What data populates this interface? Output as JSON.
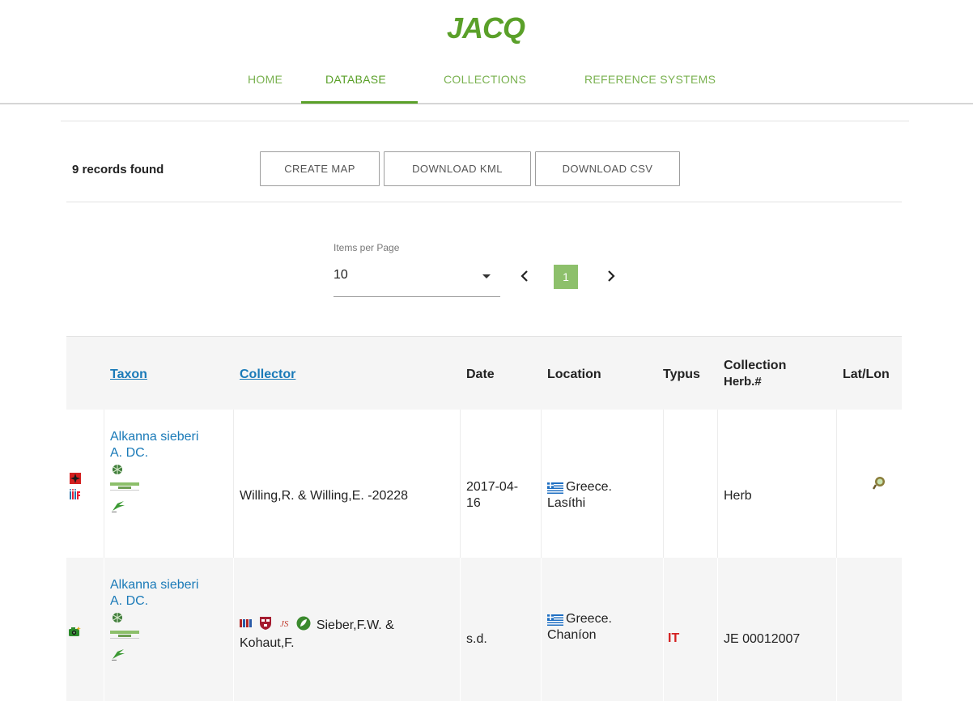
{
  "app": {
    "logo_text": "JACQ",
    "colors": {
      "brand_green": "#5aa029",
      "nav_green": "#79b14f",
      "link_blue": "#1a7ab8",
      "typus_red": "#d42020",
      "page_active": "#8dc06b"
    }
  },
  "nav": {
    "items": [
      {
        "label": "HOME"
      },
      {
        "label": "DATABASE",
        "active": true
      },
      {
        "label": "COLLECTIONS"
      },
      {
        "label": "REFERENCE SYSTEMS"
      }
    ]
  },
  "results": {
    "count_label": "9 records found",
    "buttons": {
      "create_map": "CREATE MAP",
      "download_kml": "DOWNLOAD KML",
      "download_csv": "DOWNLOAD CSV"
    }
  },
  "paging": {
    "items_per_page_label": "Items per Page",
    "items_per_page_value": "10",
    "current_page": "1",
    "prev_icon": "chevron-left-icon",
    "next_icon": "chevron-right-icon"
  },
  "table": {
    "headers": {
      "taxon": "Taxon",
      "collector": "Collector",
      "date": "Date",
      "location": "Location",
      "typus": "Typus",
      "collection_line1": "Collection",
      "collection_line2": "Herb.#",
      "latlon": "Lat/Lon"
    },
    "rows": [
      {
        "status_icons": [
          "red-star-icon",
          "iiif-icon"
        ],
        "taxon_line1": "Alkanna sieberi",
        "taxon_line2": "A. DC.",
        "taxon_icons": [
          "plant-logo-icon",
          "europlusmed-icon",
          "leaf-logo-icon"
        ],
        "collector": "Willing,R. & Willing,E. -20228",
        "collector_icons": [],
        "date_line1": "2017-04-",
        "date_line2": "16",
        "flag_icon": "greece-flag-icon",
        "location_line1": "Greece.",
        "location_line2": "Lasíthi",
        "typus": "",
        "collection": "Herb",
        "latlon_icon": "map-pin-icon"
      },
      {
        "status_icons": [
          "camera-icon"
        ],
        "taxon_line1": "Alkanna sieberi",
        "taxon_line2": "A. DC.",
        "taxon_icons": [
          "plant-logo-icon",
          "europlusmed-icon",
          "leaf-logo-icon"
        ],
        "collector_icons": [
          "library-icon",
          "harvard-shield-icon",
          "jstor-icon",
          "gbif-leaf-icon"
        ],
        "collector_line1": "Sieber,F.W. &",
        "collector_line2": "Kohaut,F.",
        "date": "s.d.",
        "flag_icon": "greece-flag-icon",
        "location_line1": "Greece.",
        "location_line2": "Chaníon",
        "typus": "IT",
        "collection": "JE 00012007",
        "latlon_icon": ""
      }
    ]
  }
}
